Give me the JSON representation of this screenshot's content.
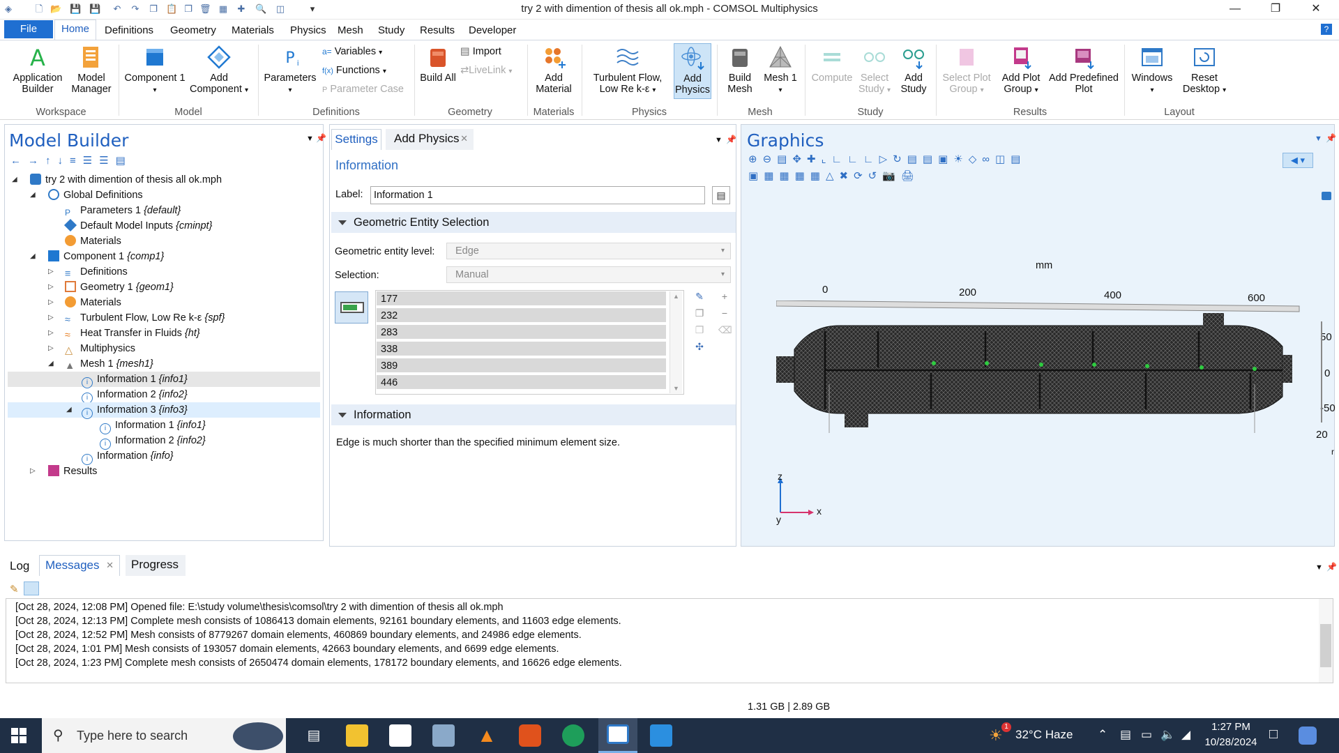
{
  "window": {
    "title": "try 2 with dimention of thesis all ok.mph - COMSOL Multiphysics"
  },
  "ribbon_tabs": [
    "File",
    "Home",
    "Definitions",
    "Geometry",
    "Materials",
    "Physics",
    "Mesh",
    "Study",
    "Results",
    "Developer"
  ],
  "ribbon": {
    "workspace": {
      "group": "Workspace",
      "app_builder": "Application Builder",
      "model_manager": "Model Manager"
    },
    "model": {
      "group": "Model",
      "component": "Component 1",
      "add_component": "Add Component"
    },
    "definitions": {
      "group": "Definitions",
      "parameters": "Parameters",
      "variables": "Variables",
      "functions": "Functions",
      "parameter_case": "Parameter Case"
    },
    "geometry": {
      "group": "Geometry",
      "build_all": "Build All",
      "import": "Import",
      "livelink": "LiveLink"
    },
    "materials": {
      "group": "Materials",
      "add_material": "Add Material"
    },
    "physics": {
      "group": "Physics",
      "turbulent": "Turbulent Flow, Low Re k-ε",
      "add_physics": "Add Physics"
    },
    "mesh": {
      "group": "Mesh",
      "build_mesh": "Build Mesh",
      "mesh1": "Mesh 1"
    },
    "study": {
      "group": "Study",
      "compute": "Compute",
      "select_study": "Select Study",
      "add_study": "Add Study"
    },
    "results": {
      "group": "Results",
      "select_plot_group": "Select Plot Group",
      "add_plot_group": "Add Plot Group",
      "add_predefined": "Add Predefined Plot"
    },
    "layout": {
      "group": "Layout",
      "windows": "Windows",
      "reset_desktop": "Reset Desktop"
    }
  },
  "model_builder": {
    "title": "Model Builder",
    "tree": [
      {
        "name": "try 2 with dimention of thesis all ok.mph",
        "tag": ""
      },
      {
        "name": "Global Definitions",
        "tag": ""
      },
      {
        "name": "Parameters 1",
        "tag": "{default}"
      },
      {
        "name": "Default Model Inputs",
        "tag": "{cminpt}"
      },
      {
        "name": "Materials",
        "tag": ""
      },
      {
        "name": "Component 1",
        "tag": "{comp1}"
      },
      {
        "name": "Definitions",
        "tag": ""
      },
      {
        "name": "Geometry 1",
        "tag": "{geom1}"
      },
      {
        "name": "Materials",
        "tag": ""
      },
      {
        "name": "Turbulent Flow, Low Re k-ε",
        "tag": "{spf}"
      },
      {
        "name": "Heat Transfer in Fluids",
        "tag": "{ht}"
      },
      {
        "name": "Multiphysics",
        "tag": ""
      },
      {
        "name": "Mesh 1",
        "tag": "{mesh1}"
      },
      {
        "name": "Information 1",
        "tag": "{info1}"
      },
      {
        "name": "Information 2",
        "tag": "{info2}"
      },
      {
        "name": "Information 3",
        "tag": "{info3}"
      },
      {
        "name": "Information 1",
        "tag": "{info1}"
      },
      {
        "name": "Information 2",
        "tag": "{info2}"
      },
      {
        "name": "Information",
        "tag": "{info}"
      },
      {
        "name": "Results",
        "tag": ""
      }
    ]
  },
  "settings": {
    "tabs": [
      "Settings",
      "Add Physics"
    ],
    "section_title": "Information",
    "label_caption": "Label:",
    "label_value": "Information 1",
    "geo_section": "Geometric Entity Selection",
    "entity_level_caption": "Geometric entity level:",
    "entity_level_value": "Edge",
    "selection_caption": "Selection:",
    "selection_value": "Manual",
    "selection_list": [
      "177",
      "232",
      "283",
      "338",
      "389",
      "446"
    ],
    "info_section": "Information",
    "info_text": "Edge is much shorter than the specified minimum element size."
  },
  "graphics": {
    "title": "Graphics",
    "axis_unit": "mm",
    "top_ticks": [
      "0",
      "200",
      "400",
      "600"
    ],
    "right_ticks": [
      "50",
      "0",
      "-50",
      "20"
    ],
    "right_edge_char": "r",
    "triad_z": "z",
    "triad_x": "x",
    "triad_y": "y"
  },
  "bottom": {
    "tabs": [
      "Log",
      "Messages",
      "Progress"
    ],
    "messages": [
      "[Oct 28, 2024, 12:08 PM] Opened file: E:\\study volume\\thesis\\comsol\\try 2 with dimention of thesis all ok.mph",
      "[Oct 28, 2024, 12:13 PM] Complete mesh consists of 1086413 domain elements, 92161 boundary elements, and 11603 edge elements.",
      "[Oct 28, 2024, 12:52 PM] Mesh consists of 8779267 domain elements, 460869 boundary elements, and 24986 edge elements.",
      "[Oct 28, 2024, 1:01 PM] Mesh consists of 193057 domain elements, 42663 boundary elements, and 6699 edge elements.",
      "[Oct 28, 2024, 1:23 PM] Complete mesh consists of 2650474 domain elements, 178172 boundary elements, and 16626 edge elements."
    ],
    "memory": "1.31 GB | 2.89 GB"
  },
  "taskbar": {
    "search_placeholder": "Type here to search",
    "weather": "32°C  Haze",
    "weather_badge": "1",
    "time": "1:27 PM",
    "date": "10/28/2024"
  }
}
